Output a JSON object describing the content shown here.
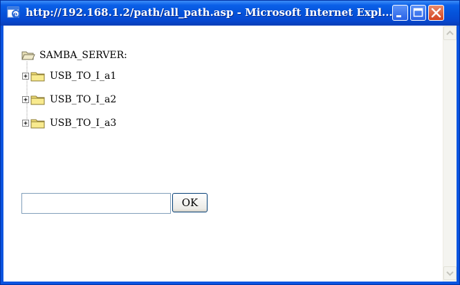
{
  "window": {
    "title": "http://192.168.1.2/path/all_path.asp - Microsoft Internet Expl..."
  },
  "tree": {
    "root_label": "SAMBA_SERVER:",
    "items": [
      {
        "label": "USB_TO_I_a1"
      },
      {
        "label": "USB_TO_I_a2"
      },
      {
        "label": "USB_TO_I_a3"
      }
    ]
  },
  "form": {
    "path_value": "",
    "ok_label": "OK"
  },
  "colors": {
    "titlebar": "#0553da",
    "close_button": "#d4421e",
    "folder": "#f5e27a"
  }
}
